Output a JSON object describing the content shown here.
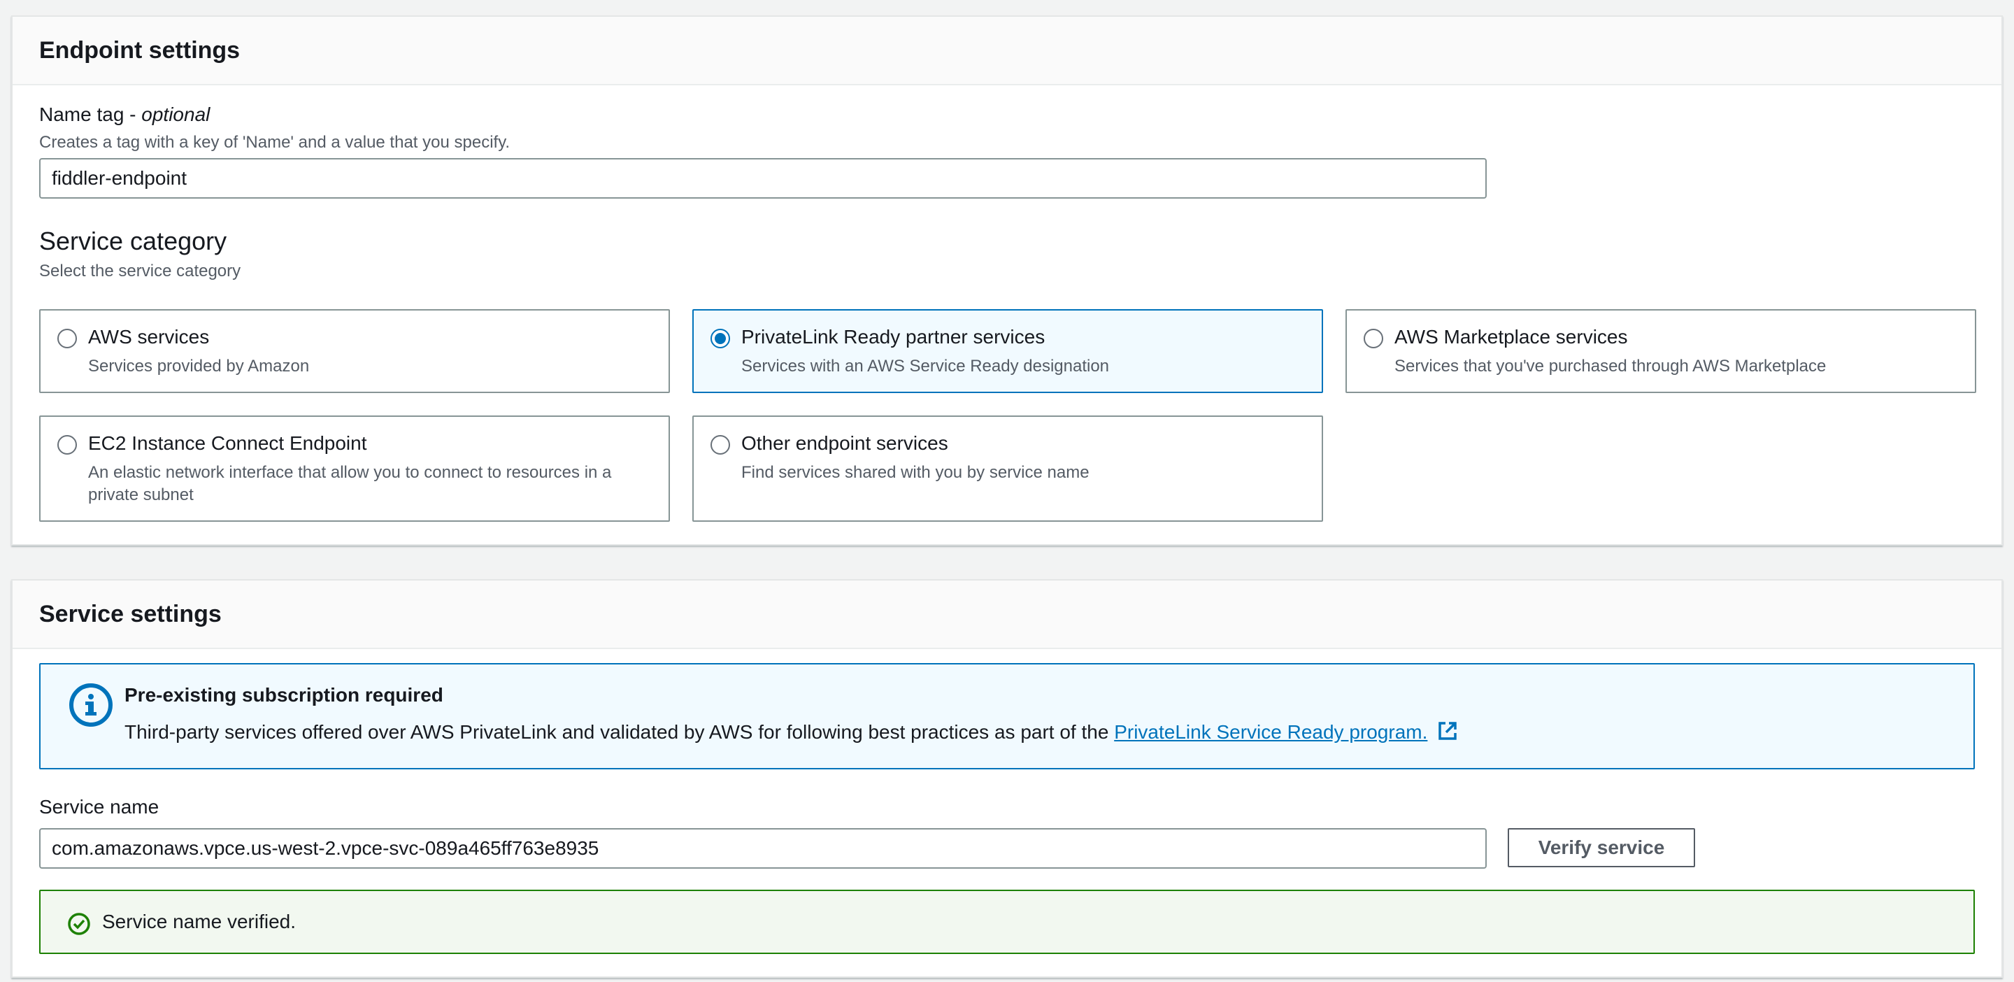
{
  "endpoint_settings": {
    "title": "Endpoint settings",
    "name_tag": {
      "label": "Name tag - ",
      "label_optional": "optional",
      "description": "Creates a tag with a key of 'Name' and a value that you specify.",
      "value": "fiddler-endpoint"
    },
    "service_category": {
      "heading": "Service category",
      "description": "Select the service category",
      "options": [
        {
          "title": "AWS services",
          "description": "Services provided by Amazon",
          "selected": false
        },
        {
          "title": "PrivateLink Ready partner services",
          "description": "Services with an AWS Service Ready designation",
          "selected": true
        },
        {
          "title": "AWS Marketplace services",
          "description": "Services that you've purchased through AWS Marketplace",
          "selected": false
        },
        {
          "title": "EC2 Instance Connect Endpoint",
          "description": "An elastic network interface that allow you to connect to resources in a private subnet",
          "selected": false
        },
        {
          "title": "Other endpoint services",
          "description": "Find services shared with you by service name",
          "selected": false
        }
      ]
    }
  },
  "service_settings": {
    "title": "Service settings",
    "info_alert": {
      "icon": "info-icon",
      "title": "Pre-existing subscription required",
      "text": "Third-party services offered over AWS PrivateLink and validated by AWS for following best practices as part of the ",
      "link_text": "PrivateLink Service Ready program.",
      "link_icon": "external-link-icon"
    },
    "service_name": {
      "label": "Service name",
      "value": "com.amazonaws.vpce.us-west-2.vpce-svc-089a465ff763e8935"
    },
    "verify_button": "Verify service",
    "success_alert": {
      "icon": "check-circle-icon",
      "text": "Service name verified."
    }
  },
  "colors": {
    "accent": "#0073bb",
    "success": "#1d8102",
    "border": "#879596",
    "text_secondary": "#545b64"
  }
}
